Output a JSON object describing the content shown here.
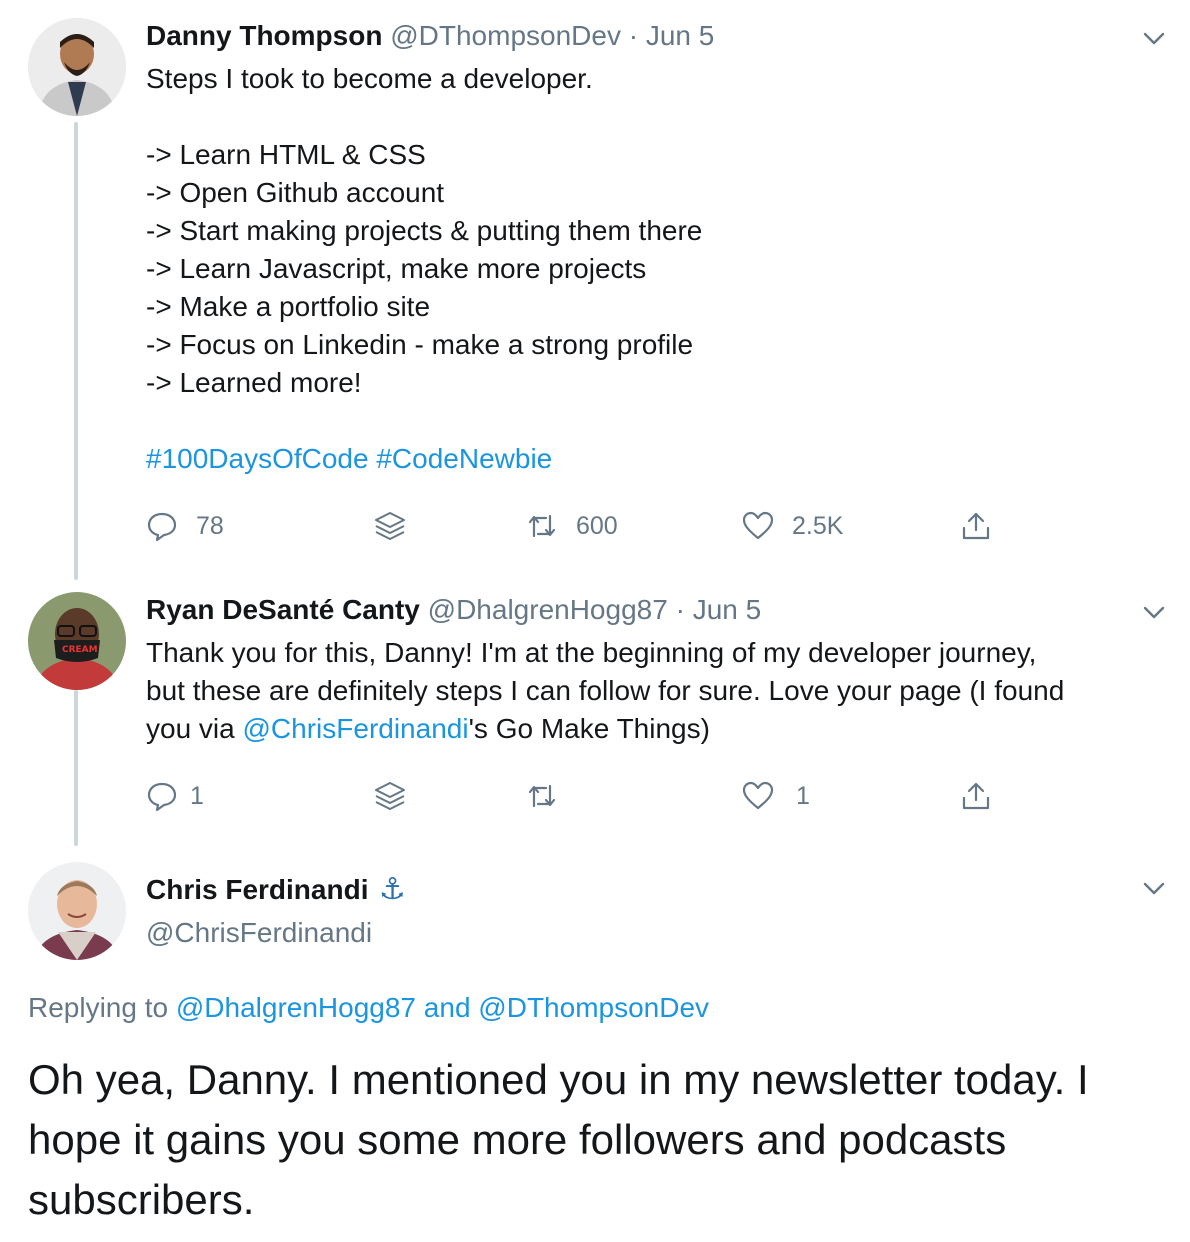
{
  "tweet1": {
    "name": "Danny Thompson",
    "handle": "@DThompsonDev",
    "sep": "·",
    "date": "Jun 5",
    "lines": [
      "Steps I took to become a developer.",
      "",
      "-> Learn HTML & CSS",
      "-> Open Github account",
      "-> Start making projects & putting them there",
      "-> Learn Javascript, make more projects",
      "-> Make a portfolio site",
      "-> Focus on Linkedin - make a strong profile",
      "-> Learned more!"
    ],
    "hashtag1": "#100DaysOfCode",
    "hashtag2": "#CodeNewbie",
    "replies": "78",
    "retweets": "600",
    "likes": "2.5K"
  },
  "tweet2": {
    "name": "Ryan DeSanté Canty",
    "handle": "@DhalgrenHogg87",
    "sep": "·",
    "date": "Jun 5",
    "text_a": "Thank you for this, Danny! I'm at the beginning of my developer journey,",
    "text_b": "but these are definitely steps I can follow for sure. Love your page (I found",
    "text_c_pre": "you via ",
    "text_c_mention": "@ChrisFerdinandi",
    "text_c_post": "'s Go Make Things)",
    "replies": "1",
    "likes": "1"
  },
  "tweet3": {
    "name": "Chris Ferdinandi",
    "name_emoji": "⚓",
    "handle": "@ChrisFerdinandi",
    "replying_prefix": "Replying to ",
    "replying_user1": "@DhalgrenHogg87",
    "replying_and": " and ",
    "replying_user2": "@DThompsonDev",
    "text": "Oh yea, Danny. I mentioned you in my newsletter today. I hope it gains you some more followers and podcasts subscribers."
  },
  "icons": {
    "reply": "reply-icon",
    "stack": "stack-icon",
    "retweet": "retweet-icon",
    "like": "heart-icon",
    "share": "share-icon",
    "more": "chevron-down-icon"
  },
  "colors": {
    "link": "#1b95e0",
    "muted": "#657786",
    "thread_line": "#ccd6dd"
  }
}
